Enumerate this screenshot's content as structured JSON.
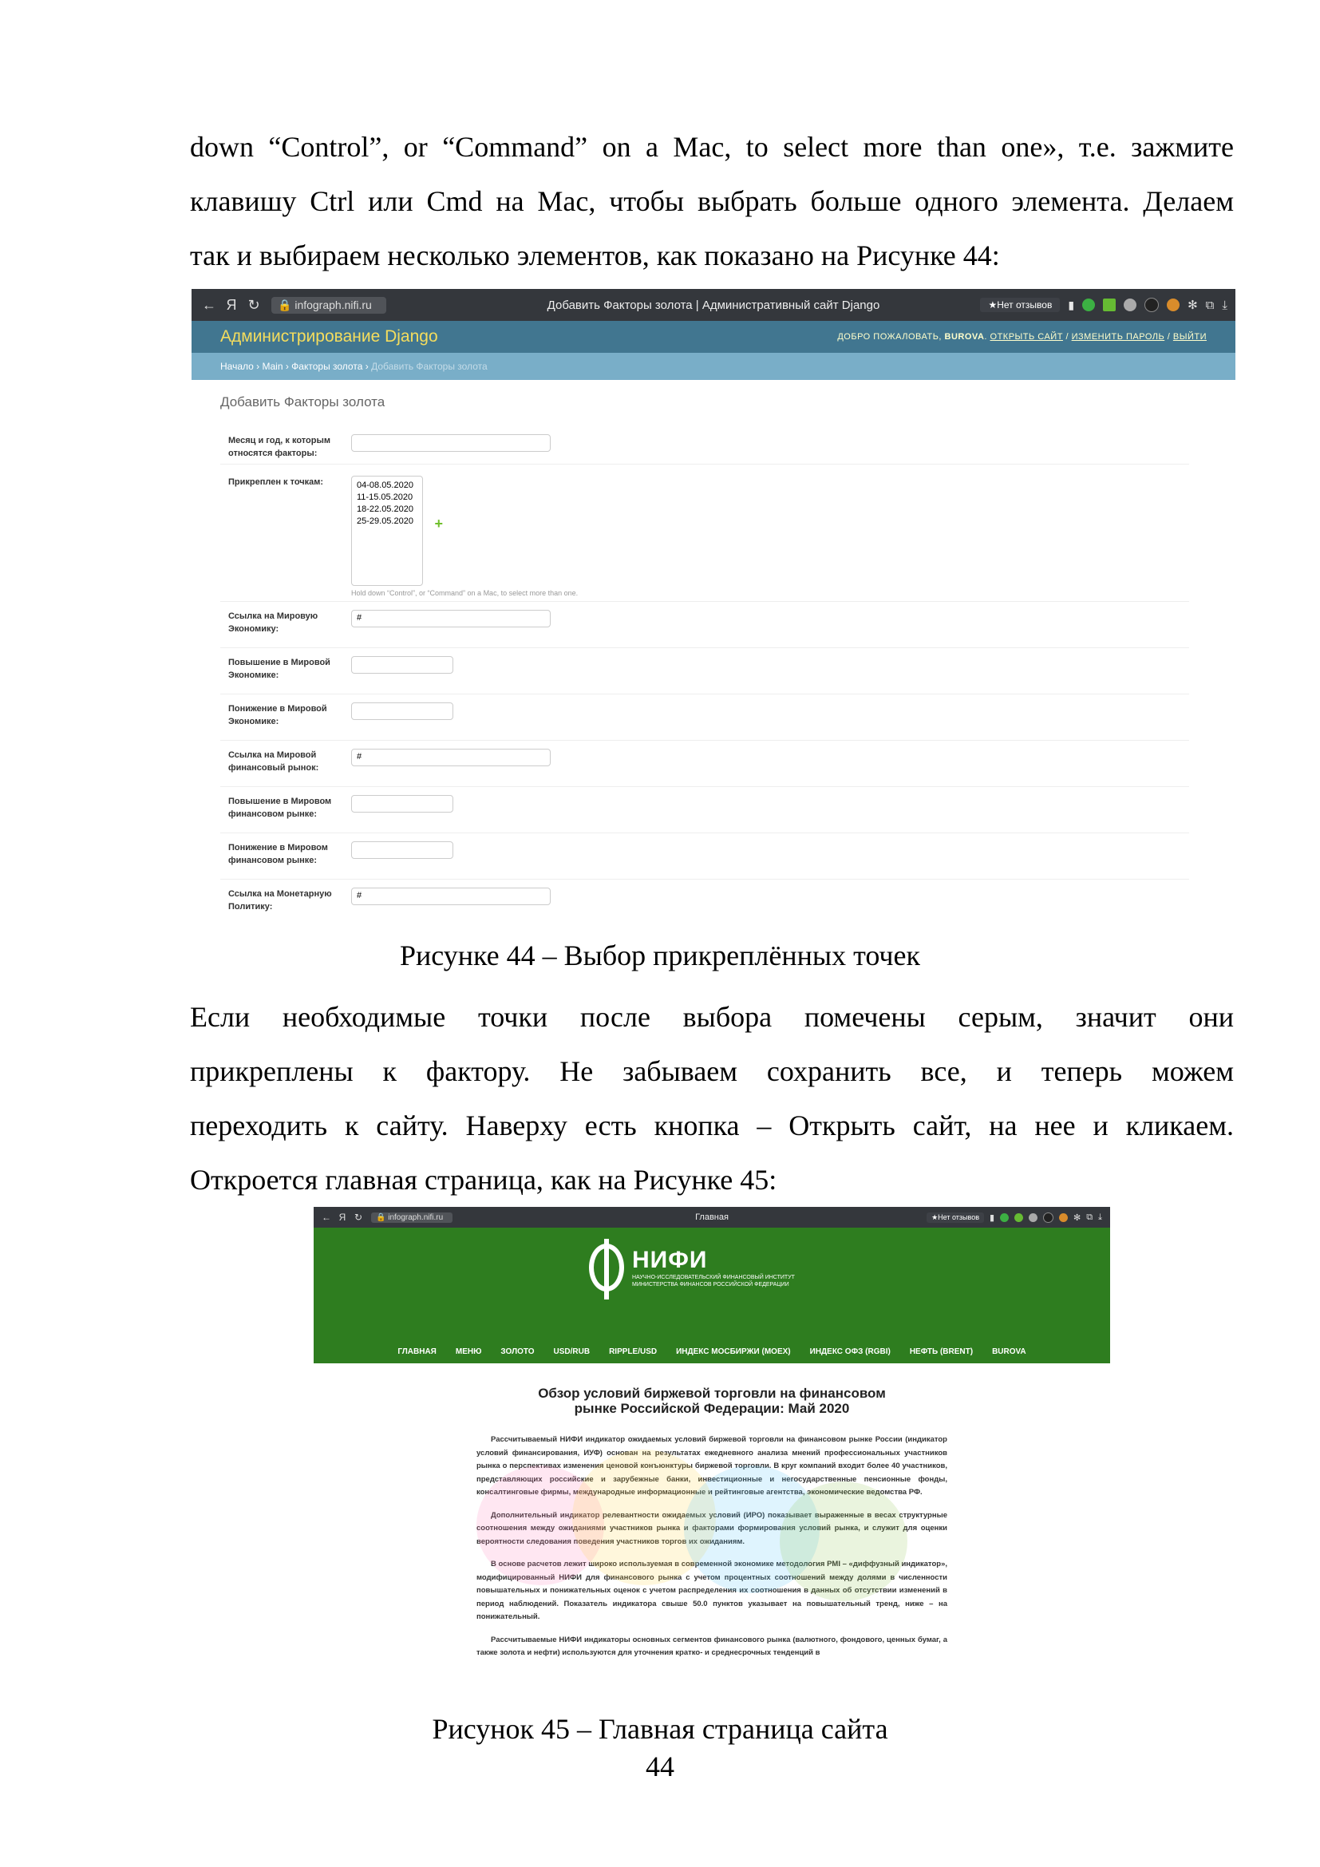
{
  "intro_paragraph": {
    "line1": "down “Control”, or “Command” on a Mac, to select more than one», т.е. зажмите",
    "line2": "клавишу Ctrl или Cmd на Mac, чтобы выбрать больше одного элемента. Делаем",
    "line3": "так и выбираем несколько элементов, как показано на Рисунке 44:"
  },
  "figure44": {
    "browser": {
      "url": "infograph.nifi.ru",
      "tab_title": "Добавить Факторы золота | Административный сайт Django",
      "reviews_label": "★Нет отзывов",
      "back_icon": "back-arrow-icon",
      "yandex_icon": "Я",
      "reload_icon": "reload-icon"
    },
    "django": {
      "brand": "Администрирование Django",
      "user_tools_prefix": "ДОБРО ПОЖАЛОВАТЬ,",
      "username": "BUROVA",
      "open_site": "ОТКРЫТЬ САЙТ",
      "change_password": "ИЗМЕНИТЬ ПАРОЛЬ",
      "logout": "ВЫЙТИ",
      "breadcrumbs": [
        "Начало",
        "Main",
        "Факторы золота"
      ],
      "breadcrumb_current": "Добавить Факторы золота",
      "page_title": "Добавить Факторы золота",
      "fields": [
        {
          "label": "Месяц и год, к которым относятся факторы:",
          "value": "",
          "width": "wide"
        },
        {
          "label": "Прикреплен к точкам:",
          "type": "multiselect",
          "options": [
            "04-08.05.2020",
            "11-15.05.2020",
            "18-22.05.2020",
            "25-29.05.2020"
          ],
          "help": "Hold down “Control”, or “Command” on a Mac, to select more than one."
        },
        {
          "label": "Ссылка на Мировую Экономику:",
          "value": "#",
          "width": "wide"
        },
        {
          "label": "Повышение в Мировой Экономике:",
          "value": "",
          "width": "narrow"
        },
        {
          "label": "Понижение в Мировой Экономике:",
          "value": "",
          "width": "narrow"
        },
        {
          "label": "Ссылка на Мировой финансовый рынок:",
          "value": "#",
          "width": "wide"
        },
        {
          "label": "Повышение в Мировом финансовом рынке:",
          "value": "",
          "width": "narrow"
        },
        {
          "label": "Понижение в Мировом финансовом рынке:",
          "value": "",
          "width": "narrow"
        },
        {
          "label": "Ссылка на Монетарную Политику:",
          "value": "#",
          "width": "wide"
        }
      ]
    }
  },
  "caption44": "Рисунке 44 – Выбор прикреплённых точек",
  "middle_paragraph": {
    "line1": "Если необходимые точки после выбора помечены серым, значит они",
    "line2": "прикреплены к фактору. Не забываем сохранить все, и теперь можем",
    "line3": "переходить к сайту. Наверху есть кнопка – Открыть сайт, на нее и кликаем.",
    "line4": "Откроется главная страница, как на Рисунке 45:"
  },
  "figure45": {
    "browser": {
      "url": "infograph.nifi.ru",
      "tab_title": "Главная",
      "reviews_label": "★Нет отзывов"
    },
    "logo_name": "НИФИ",
    "logo_sub1": "НАУЧНО-ИССЛЕДОВАТЕЛЬСКИЙ ФИНАНСОВЫЙ ИНСТИТУТ",
    "logo_sub2": "МИНИСТЕРСТВА ФИНАНСОВ РОССИЙСКОЙ ФЕДЕРАЦИИ",
    "nav": [
      "ГЛАВНАЯ",
      "МЕНЮ",
      "ЗОЛОТО",
      "USD/RUB",
      "RIPPLE/USD",
      "ИНДЕКС МОСБИРЖИ (MOEX)",
      "ИНДЕКС ОФЗ (RGBI)",
      "НЕФТЬ (BRENT)",
      "BUROVA"
    ],
    "article_title_1": "Обзор условий биржевой торговли на финансовом",
    "article_title_2": "рынке Российской Федерации: Май 2020",
    "paragraphs": [
      "Рассчитываемый НИФИ индикатор ожидаемых условий биржевой торговли на финансовом рынке России (индикатор условий финансирования, ИУФ) основан на результатах ежедневного анализа мнений профессиональных участников рынка о перспективах изменения ценовой конъюнктуры биржевой торговли. В круг компаний входит более 40 участников, представляющих российские и зарубежные банки, инвестиционные и негосударственные пенсионные фонды, консалтинговые фирмы, международные информационные и рейтинговые агентства, экономические ведомства РФ.",
      "Дополнительный индикатор релевантности ожидаемых условий (ИРО) показывает выраженные в весах структурные соотношения между ожиданиями участников рынка и факторами формирования условий рынка, и служит для оценки вероятности следования поведения участников торгов их ожиданиям.",
      "В основе расчетов лежит широко используемая в современной экономике методология PMI – «диффузный индикатор», модифицированный НИФИ для финансового рынка с учетом процентных соотношений между долями в численности повышательных и понижательных оценок с учетом распределения их соотношения в данных об отсутствии изменений в период наблюдений. Показатель индикатора свыше 50.0 пунктов указывает на повышательный тренд, ниже – на понижательный.",
      "Рассчитываемые НИФИ индикаторы основных сегментов финансового рынка (валютного, фондового, ценных бумаг, а также золота и нефти) используются для уточнения кратко- и среднесрочных тенденций в"
    ]
  },
  "caption45": "Рисунок 45 – Главная страница сайта",
  "page_number": "44"
}
